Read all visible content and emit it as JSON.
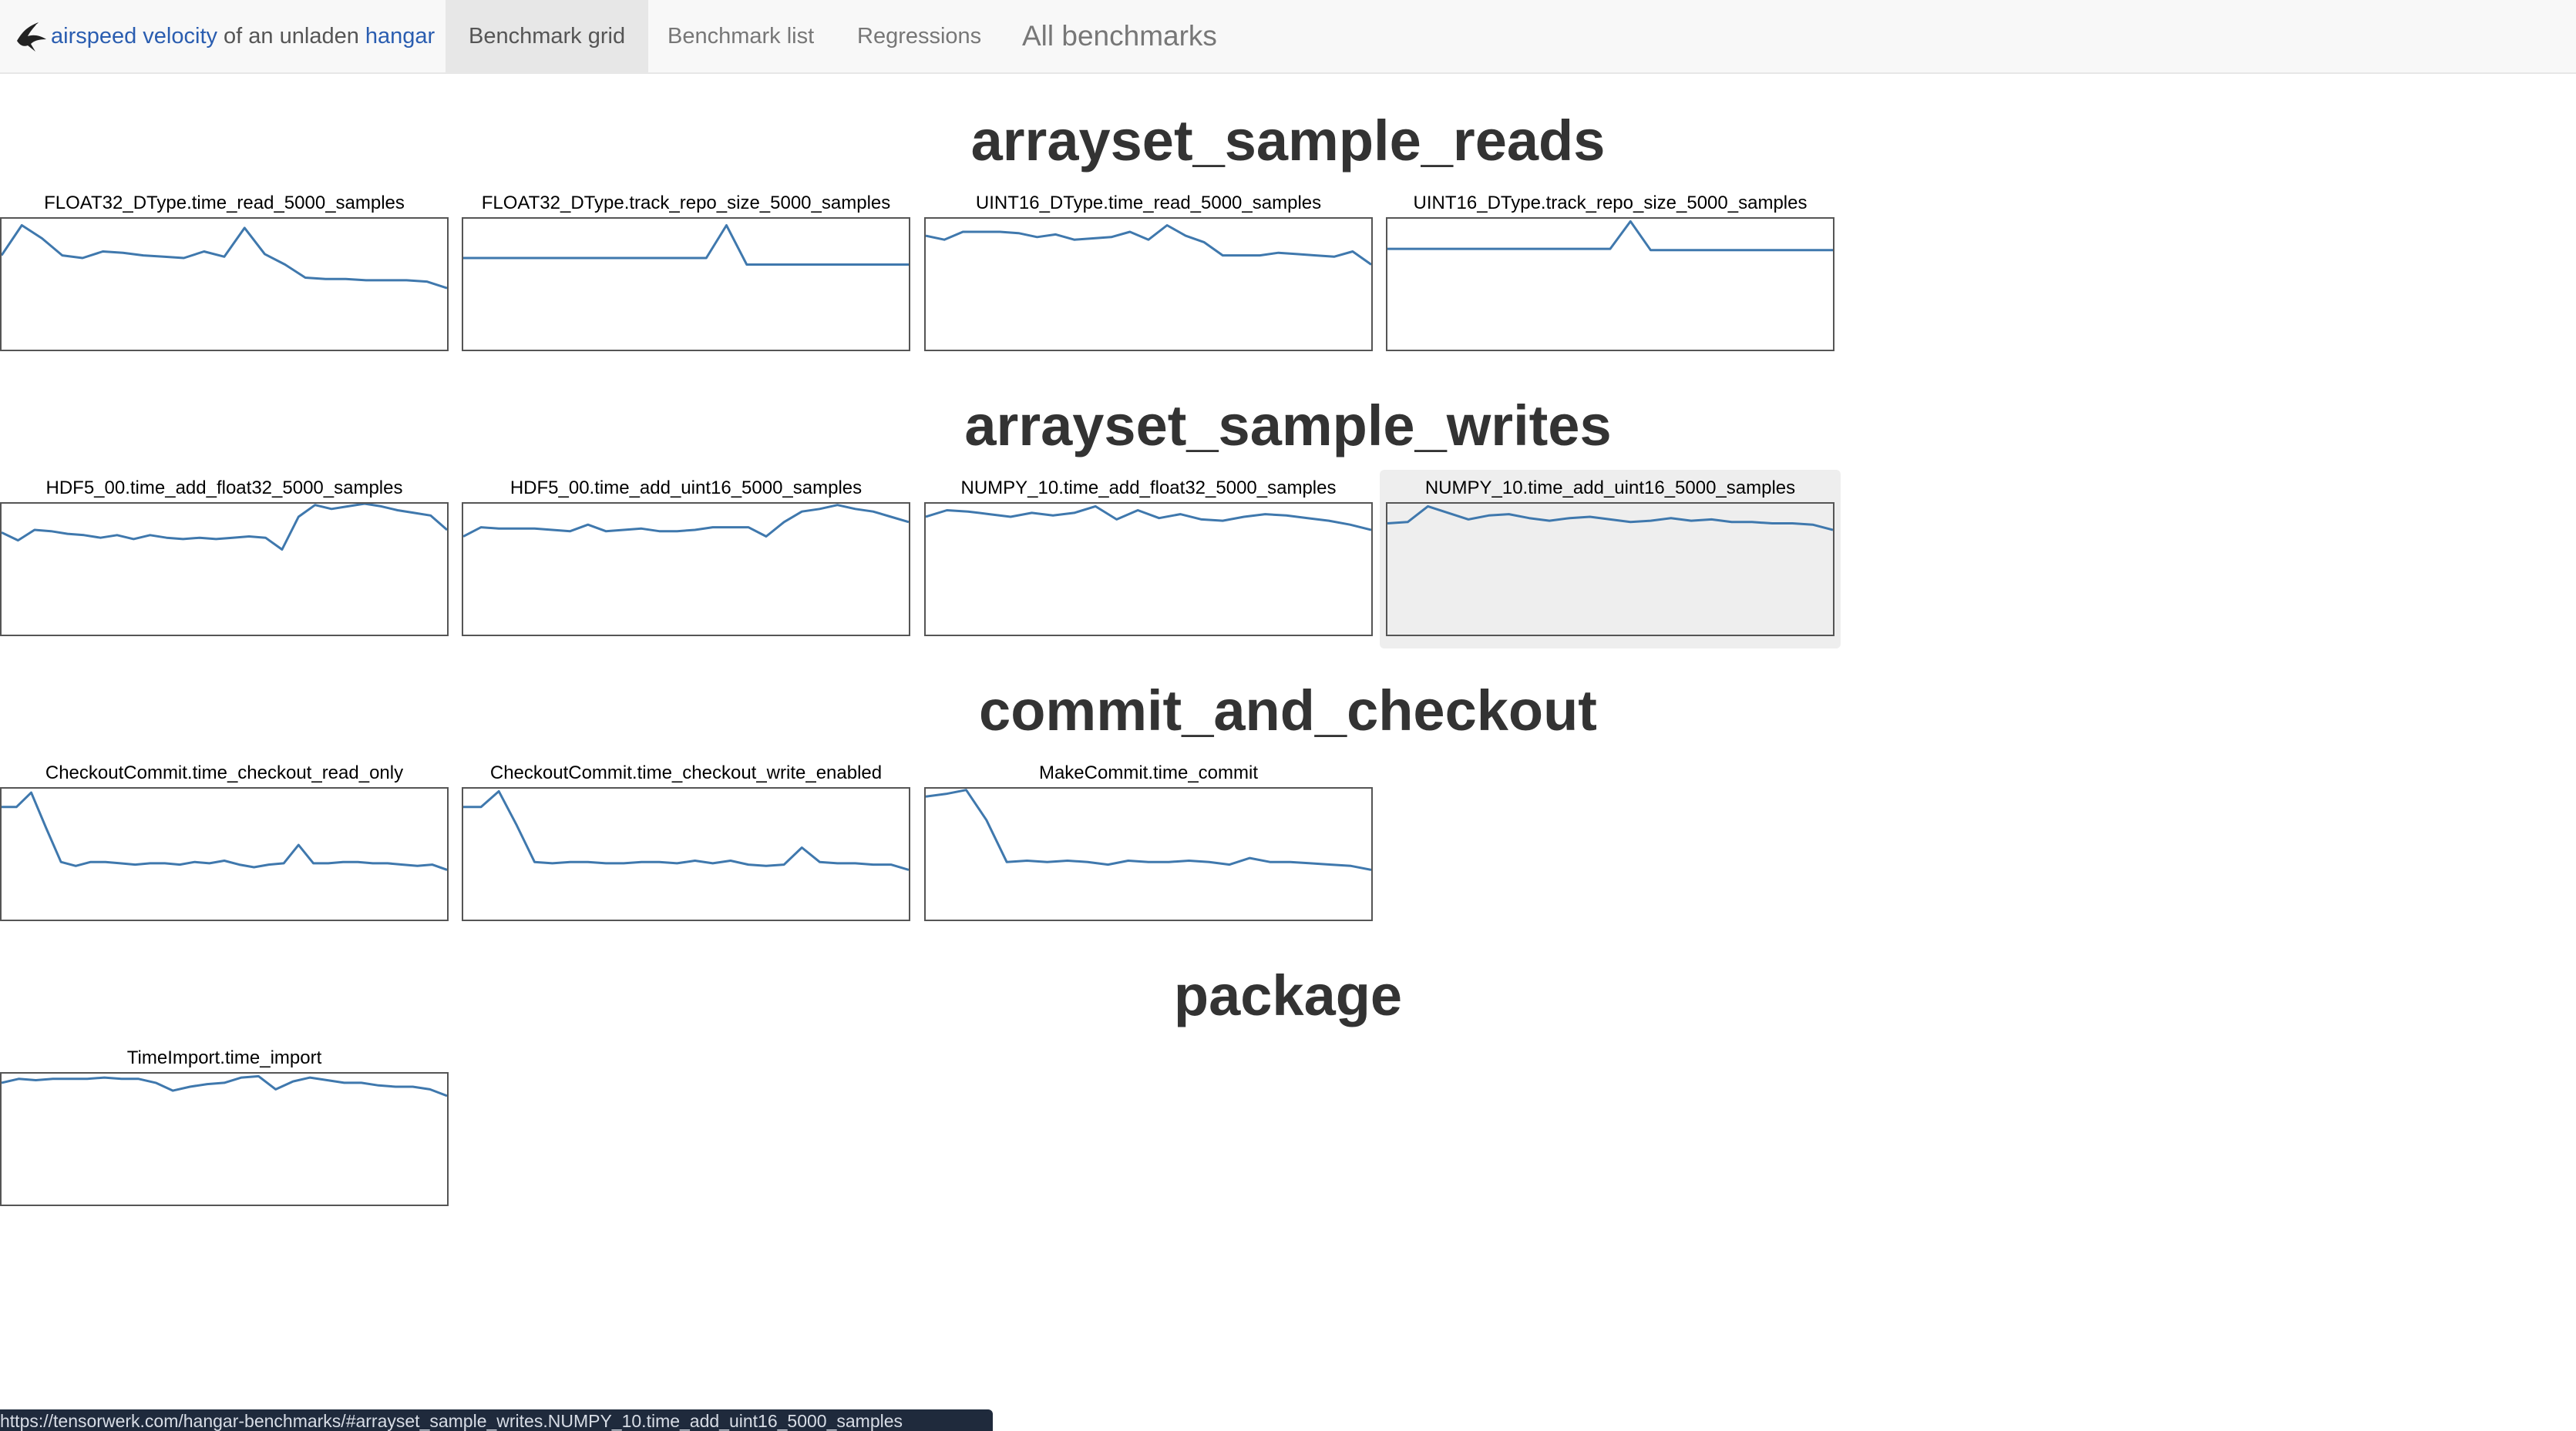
{
  "navbar": {
    "brand_link1": "airspeed velocity",
    "brand_mid": " of an unladen ",
    "brand_link2": "hangar",
    "items": [
      {
        "label": "Benchmark grid",
        "active": true
      },
      {
        "label": "Benchmark list",
        "active": false
      },
      {
        "label": "Regressions",
        "active": false
      },
      {
        "label": "All benchmarks",
        "active": false
      }
    ]
  },
  "groups": [
    {
      "title": "arrayset_sample_reads",
      "benchmarks": [
        {
          "name": "FLOAT32_DType.time_read_5000_samples",
          "series": [
            0.72,
            0.95,
            0.85,
            0.72,
            0.7,
            0.75,
            0.74,
            0.72,
            0.71,
            0.7,
            0.75,
            0.71,
            0.93,
            0.73,
            0.65,
            0.55,
            0.54,
            0.54,
            0.53,
            0.53,
            0.53,
            0.52,
            0.47
          ]
        },
        {
          "name": "FLOAT32_DType.track_repo_size_5000_samples",
          "series": [
            0.7,
            0.7,
            0.7,
            0.7,
            0.7,
            0.7,
            0.7,
            0.7,
            0.7,
            0.7,
            0.7,
            0.7,
            0.7,
            0.95,
            0.65,
            0.65,
            0.65,
            0.65,
            0.65,
            0.65,
            0.65,
            0.65,
            0.65
          ]
        },
        {
          "name": "UINT16_DType.time_read_5000_samples",
          "series": [
            0.87,
            0.84,
            0.9,
            0.9,
            0.9,
            0.89,
            0.86,
            0.88,
            0.84,
            0.85,
            0.86,
            0.9,
            0.84,
            0.95,
            0.87,
            0.82,
            0.72,
            0.72,
            0.72,
            0.74,
            0.73,
            0.72,
            0.71,
            0.75,
            0.65
          ]
        },
        {
          "name": "UINT16_DType.track_repo_size_5000_samples",
          "series": [
            0.77,
            0.77,
            0.77,
            0.77,
            0.77,
            0.77,
            0.77,
            0.77,
            0.77,
            0.77,
            0.77,
            0.77,
            0.98,
            0.76,
            0.76,
            0.76,
            0.76,
            0.76,
            0.76,
            0.76,
            0.76,
            0.76,
            0.76
          ]
        }
      ]
    },
    {
      "title": "arrayset_sample_writes",
      "benchmarks": [
        {
          "name": "HDF5_00.time_add_float32_5000_samples",
          "series": [
            0.78,
            0.72,
            0.8,
            0.79,
            0.77,
            0.76,
            0.74,
            0.76,
            0.73,
            0.76,
            0.74,
            0.73,
            0.74,
            0.73,
            0.74,
            0.75,
            0.74,
            0.65,
            0.9,
            0.99,
            0.96,
            0.98,
            1.0,
            0.98,
            0.95,
            0.93,
            0.91,
            0.8
          ]
        },
        {
          "name": "HDF5_00.time_add_uint16_5000_samples",
          "series": [
            0.75,
            0.82,
            0.81,
            0.81,
            0.81,
            0.8,
            0.79,
            0.84,
            0.79,
            0.8,
            0.81,
            0.79,
            0.79,
            0.8,
            0.82,
            0.82,
            0.82,
            0.75,
            0.86,
            0.94,
            0.96,
            0.99,
            0.96,
            0.94,
            0.9,
            0.86
          ]
        },
        {
          "name": "NUMPY_10.time_add_float32_5000_samples",
          "series": [
            0.9,
            0.95,
            0.94,
            0.92,
            0.9,
            0.93,
            0.91,
            0.93,
            0.98,
            0.88,
            0.95,
            0.89,
            0.92,
            0.88,
            0.87,
            0.9,
            0.92,
            0.91,
            0.89,
            0.87,
            0.84,
            0.8
          ]
        },
        {
          "name": "NUMPY_10.time_add_uint16_5000_samples",
          "series": [
            0.85,
            0.86,
            0.98,
            0.93,
            0.88,
            0.91,
            0.92,
            0.89,
            0.87,
            0.89,
            0.9,
            0.88,
            0.86,
            0.87,
            0.89,
            0.87,
            0.88,
            0.86,
            0.86,
            0.85,
            0.85,
            0.84,
            0.8
          ]
        }
      ]
    },
    {
      "title": "commit_and_checkout",
      "benchmarks": [
        {
          "name": "CheckoutCommit.time_checkout_read_only",
          "series": [
            0.86,
            0.86,
            0.97,
            0.7,
            0.44,
            0.41,
            0.44,
            0.44,
            0.43,
            0.42,
            0.43,
            0.43,
            0.42,
            0.44,
            0.43,
            0.45,
            0.42,
            0.4,
            0.42,
            0.43,
            0.57,
            0.43,
            0.43,
            0.44,
            0.44,
            0.43,
            0.43,
            0.42,
            0.41,
            0.42,
            0.38
          ]
        },
        {
          "name": "CheckoutCommit.time_checkout_write_enabled",
          "series": [
            0.86,
            0.86,
            0.98,
            0.72,
            0.44,
            0.43,
            0.44,
            0.44,
            0.43,
            0.43,
            0.44,
            0.44,
            0.43,
            0.45,
            0.43,
            0.45,
            0.42,
            0.41,
            0.42,
            0.55,
            0.44,
            0.43,
            0.43,
            0.42,
            0.42,
            0.38
          ]
        },
        {
          "name": "MakeCommit.time_commit",
          "series": [
            0.94,
            0.96,
            0.99,
            0.76,
            0.44,
            0.45,
            0.44,
            0.45,
            0.44,
            0.42,
            0.45,
            0.44,
            0.44,
            0.45,
            0.44,
            0.42,
            0.47,
            0.44,
            0.44,
            0.43,
            0.42,
            0.41,
            0.38
          ]
        }
      ]
    },
    {
      "title": "package",
      "benchmarks": [
        {
          "name": "TimeImport.time_import",
          "series": [
            0.93,
            0.96,
            0.95,
            0.96,
            0.96,
            0.96,
            0.97,
            0.96,
            0.96,
            0.93,
            0.87,
            0.9,
            0.92,
            0.93,
            0.97,
            0.98,
            0.88,
            0.94,
            0.97,
            0.95,
            0.93,
            0.93,
            0.91,
            0.9,
            0.9,
            0.88,
            0.83
          ]
        }
      ]
    }
  ],
  "status_bar": {
    "url": "https://tensorwerk.com/hangar-benchmarks/#arrayset_sample_writes.NUMPY_10.time_add_uint16_5000_samples"
  },
  "colors": {
    "line": "#3f78ad",
    "tile_border": "#555555",
    "hover_bg": "#eeeeee",
    "link": "#2a5db0"
  }
}
